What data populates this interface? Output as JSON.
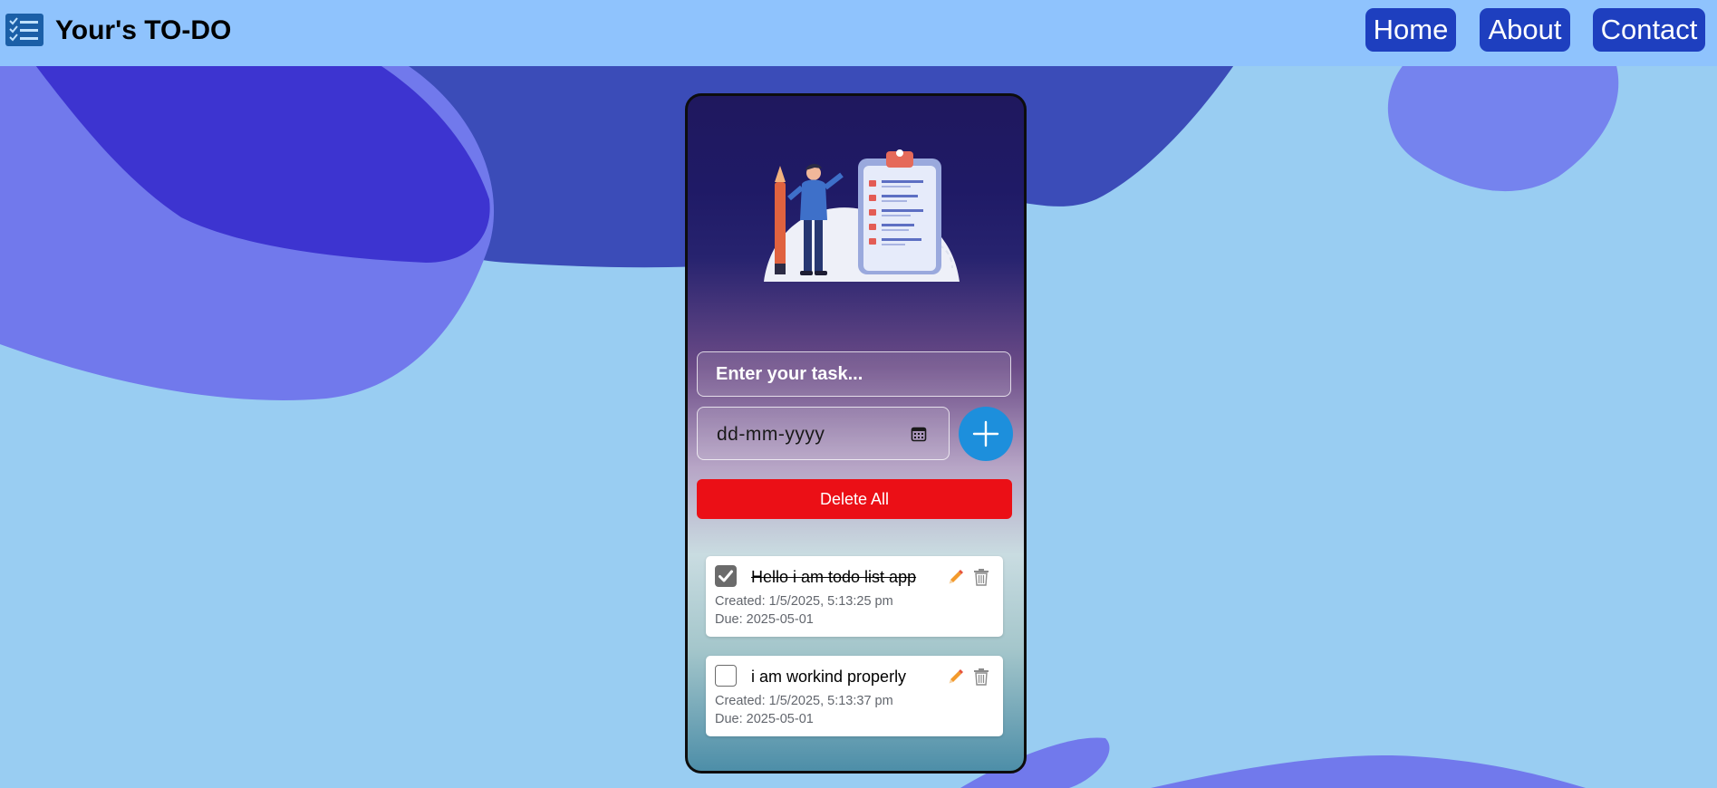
{
  "navbar": {
    "brand_title": "Your's TO-DO",
    "brand_icon": "checklist-icon",
    "links": [
      {
        "label": "Home"
      },
      {
        "label": "About"
      },
      {
        "label": "Contact"
      }
    ]
  },
  "form": {
    "task_placeholder": "Enter your task...",
    "date_placeholder": "dd-mm-yyyy",
    "add_icon": "plus-icon",
    "delete_all_label": "Delete All"
  },
  "todos": [
    {
      "text": "Hello i am todo list app",
      "completed": true,
      "created": "Created: 1/5/2025, 5:13:25 pm",
      "due": "Due: 2025-05-01"
    },
    {
      "text": "i am workind properly",
      "completed": false,
      "created": "Created: 1/5/2025, 5:13:37 pm",
      "due": "Due: 2025-05-01"
    }
  ],
  "colors": {
    "navbar": "#8fc3fd",
    "nav_button": "#1e3fbf",
    "delete_all": "#eb0f16",
    "add_button": "#1d8fdc",
    "background": "#99cdf2"
  }
}
